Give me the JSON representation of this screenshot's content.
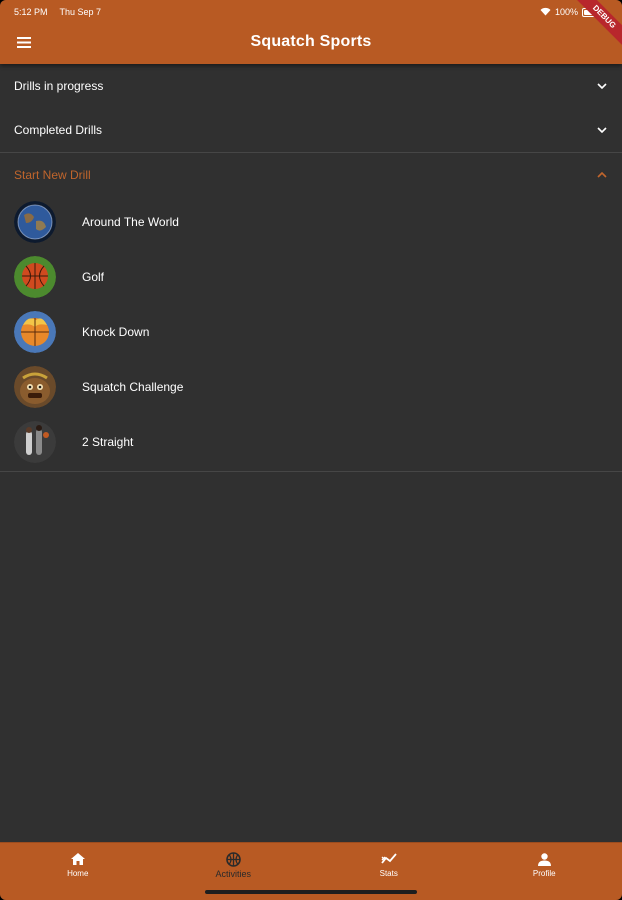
{
  "status_bar": {
    "time": "5:12 PM",
    "date": "Thu Sep 7",
    "battery": "100%"
  },
  "app": {
    "title": "Squatch Sports",
    "debug_label": "DEBUG"
  },
  "colors": {
    "accent": "#b85a23",
    "background": "#303030",
    "active_header": "#c0652c"
  },
  "panels": [
    {
      "label": "Drills in progress",
      "expanded": false
    },
    {
      "label": "Completed Drills",
      "expanded": false
    },
    {
      "label": "Start New Drill",
      "expanded": true
    }
  ],
  "drills": [
    {
      "label": "Around The World",
      "icon": "globe-icon"
    },
    {
      "label": "Golf",
      "icon": "basketball-on-grass-icon"
    },
    {
      "label": "Knock Down",
      "icon": "flaming-basketball-icon"
    },
    {
      "label": "Squatch Challenge",
      "icon": "squatch-mascot-icon"
    },
    {
      "label": "2 Straight",
      "icon": "players-photo-icon"
    }
  ],
  "bottom_nav": [
    {
      "label": "Home",
      "icon": "home-icon",
      "selected": false
    },
    {
      "label": "Activities",
      "icon": "basketball-icon",
      "selected": true
    },
    {
      "label": "Stats",
      "icon": "stats-icon",
      "selected": false
    },
    {
      "label": "Profile",
      "icon": "person-icon",
      "selected": false
    }
  ]
}
